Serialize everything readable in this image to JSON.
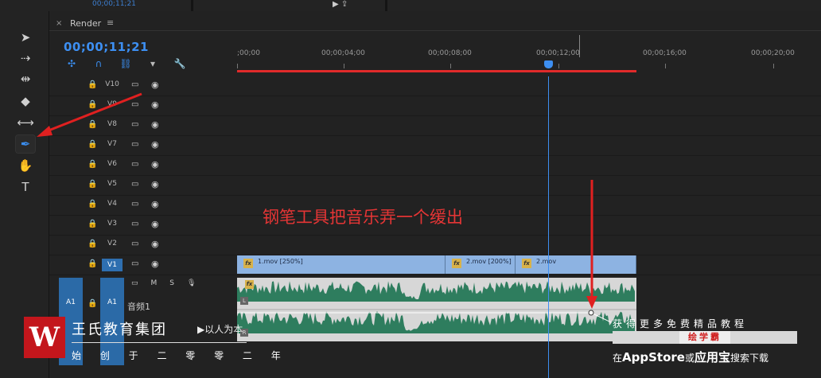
{
  "top_strip": {
    "timecode": "00;00;11;21",
    "icons": "▶ ⇪"
  },
  "tools": [
    {
      "name": "selection-tool",
      "glyph": "➤",
      "active": false
    },
    {
      "name": "track-select-tool",
      "glyph": "⇢",
      "active": false
    },
    {
      "name": "ripple-edit-tool",
      "glyph": "⇹",
      "active": false
    },
    {
      "name": "razor-tool",
      "glyph": "◆",
      "active": false
    },
    {
      "name": "slip-tool",
      "glyph": "⟷",
      "active": false
    },
    {
      "name": "pen-tool",
      "glyph": "✒",
      "active": true
    },
    {
      "name": "hand-tool",
      "glyph": "✋",
      "active": false
    },
    {
      "name": "type-tool",
      "glyph": "T",
      "active": false
    }
  ],
  "panel": {
    "close": "×",
    "title": "Render",
    "menu": "≡",
    "timecode": "00;00;11;21"
  },
  "timeline_tools": [
    {
      "name": "nest-icon",
      "glyph": "✣"
    },
    {
      "name": "snap-icon",
      "glyph": "∩"
    },
    {
      "name": "linked-selection-icon",
      "glyph": "⛓"
    },
    {
      "name": "add-marker-icon",
      "glyph": "▾"
    },
    {
      "name": "wrench-icon",
      "glyph": "🔧"
    }
  ],
  "ruler": {
    "labels": [
      ";00;00",
      "00;00;04;00",
      "00;00;08;00",
      "00;00;12;00",
      "00;00;16;00",
      "00;00;20;00"
    ]
  },
  "video_tracks": [
    "V10",
    "V9",
    "V8",
    "V7",
    "V6",
    "V5",
    "V4",
    "V3",
    "V2",
    "V1"
  ],
  "target_video_track": "V1",
  "icons": {
    "lock": "🔒",
    "sync": "▭",
    "eye": "◉",
    "mic": "🎙"
  },
  "audio_track": {
    "source": "A1",
    "target": "A1",
    "m": "M",
    "s": "S",
    "name": "音频1"
  },
  "video_clips": [
    {
      "fx": "fx",
      "name": "1.mov [250%]"
    },
    {
      "fx": "fx",
      "name": "2.mov [200%]"
    },
    {
      "fx": "fx",
      "name": "2.mov"
    }
  ],
  "audio_clip": {
    "fx": "fx",
    "left_ch": "L",
    "right_ch": "R"
  },
  "annotation": {
    "text": "钢笔工具把音乐弄一个缓出"
  },
  "watermark_left": {
    "logo": "W",
    "company": "王氏教育集团",
    "slogan": "▶以人为本",
    "founded": "始 创 于 二 零 零 二 年"
  },
  "watermark_right": {
    "line1": "获得更多免费精品教程",
    "brand": "绘学霸",
    "line2_prefix": "在",
    "line2_app": "AppStore",
    "line2_mid": "或",
    "line2_app2": "应用宝",
    "line2_suffix": "搜索下载"
  },
  "colors": {
    "accent": "#3d8ff2",
    "work_area": "#e12a2a",
    "annotation": "#e53535",
    "waveform": "#2e7d5e",
    "video_clip": "#8db3e2"
  }
}
